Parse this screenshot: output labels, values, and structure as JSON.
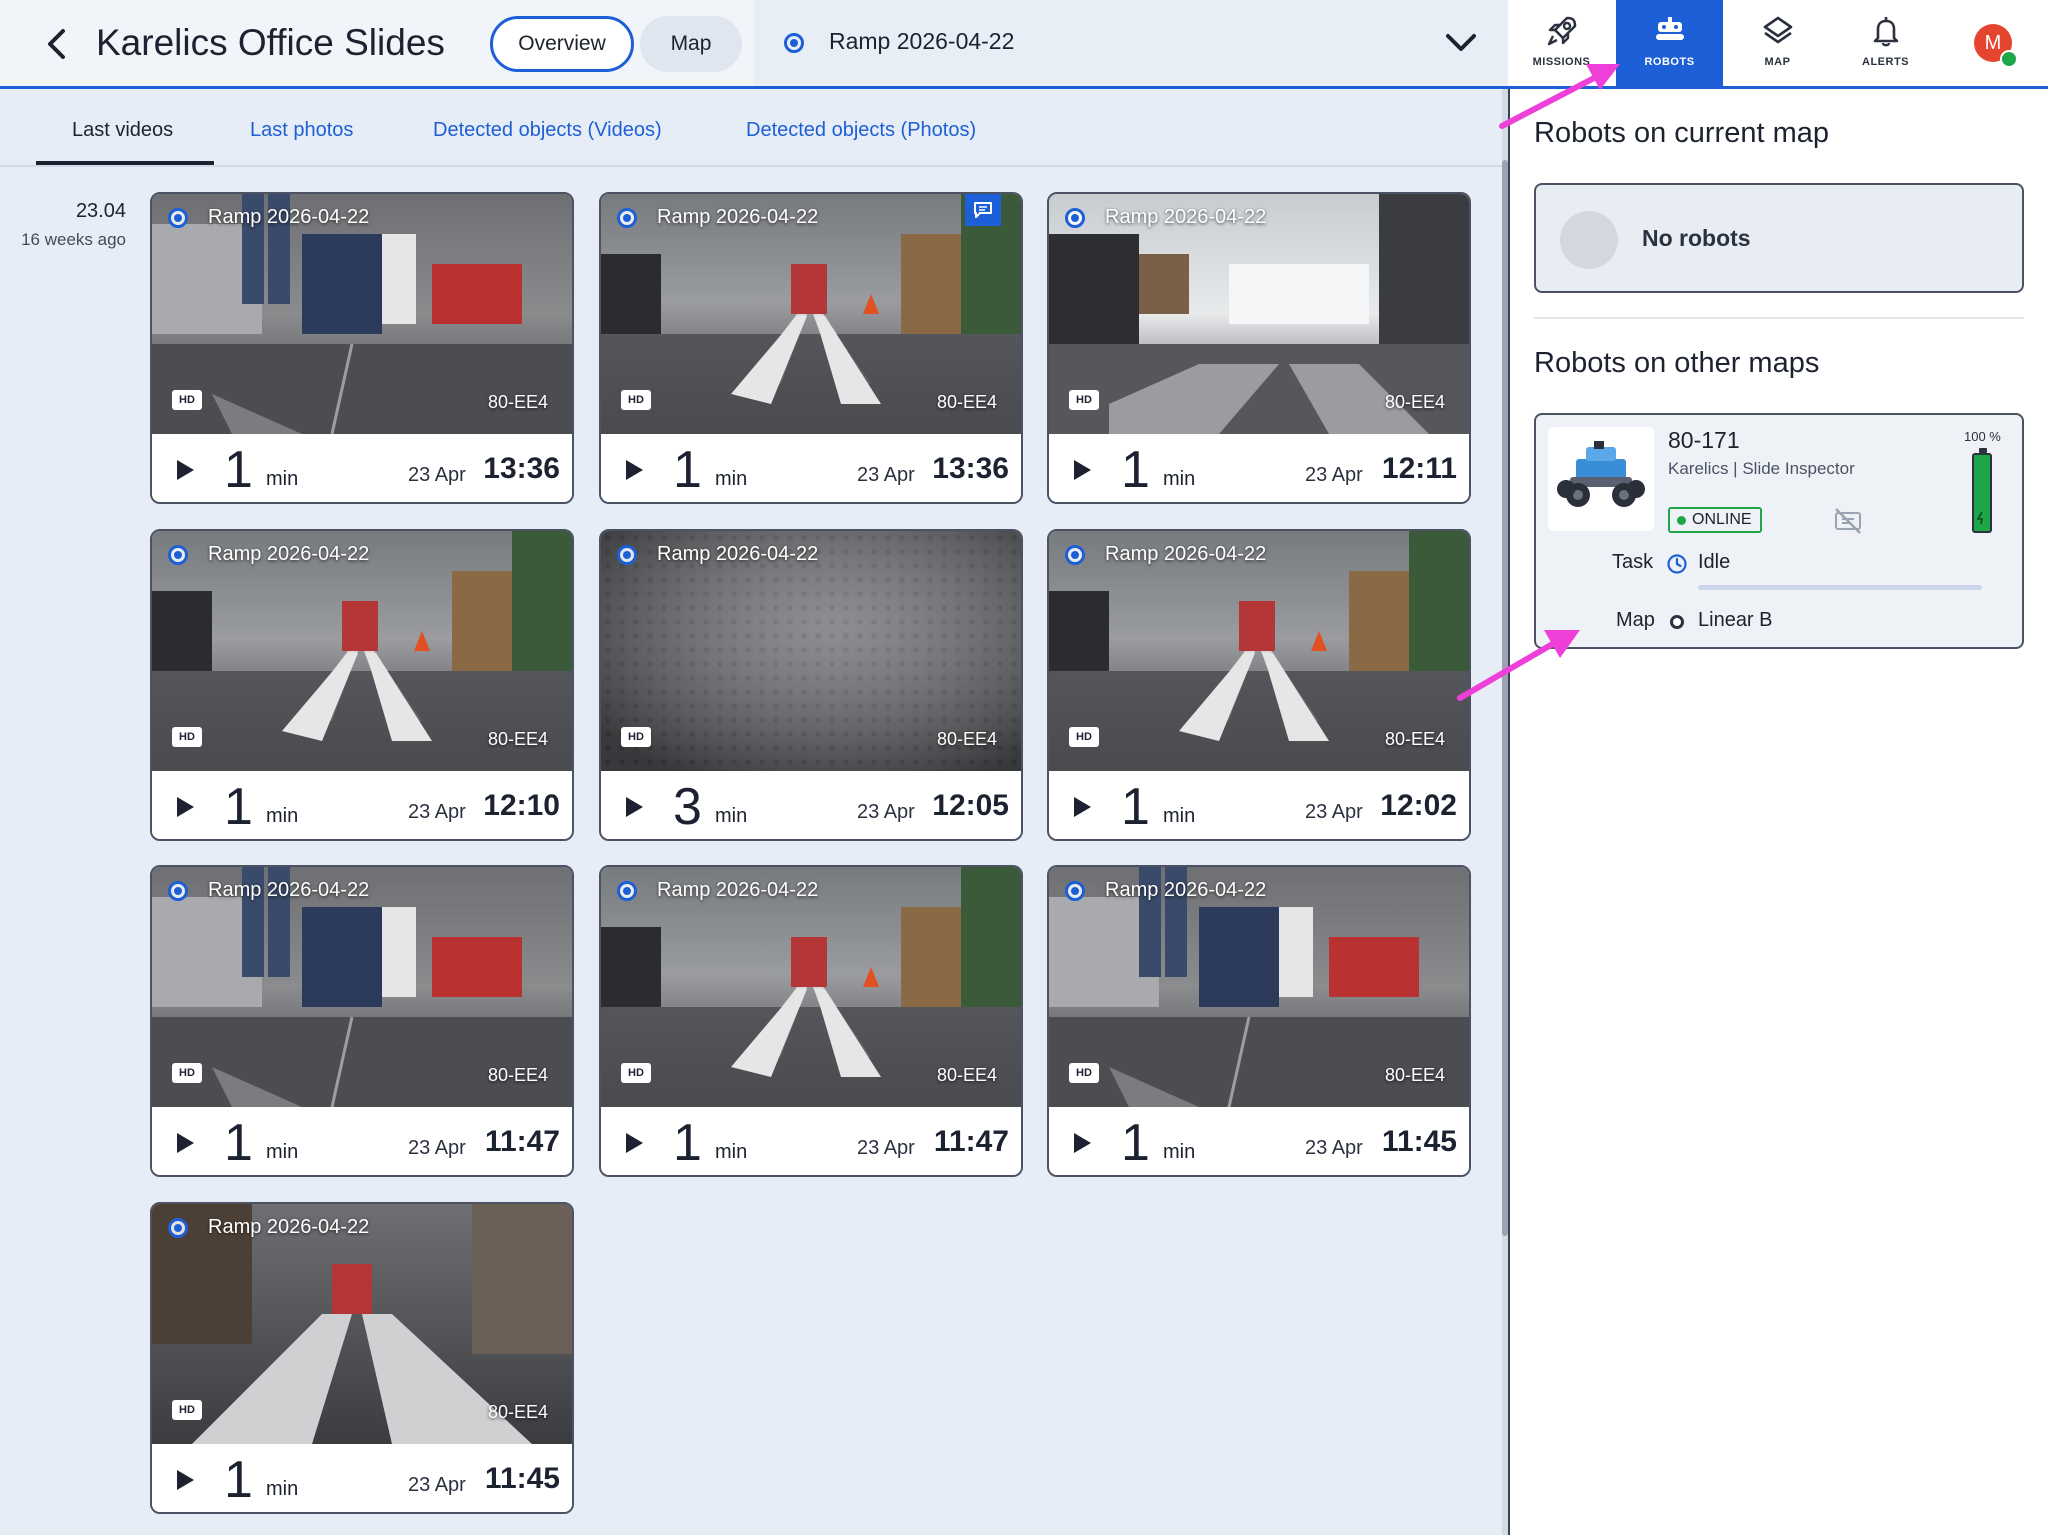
{
  "header": {
    "title": "Karelics Office Slides",
    "tab_overview": "Overview",
    "tab_map": "Map",
    "mission_select": "Ramp 2026-04-22"
  },
  "topnav": {
    "items": [
      {
        "label": "MISSIONS",
        "icon": "rocket-icon"
      },
      {
        "label": "ROBOTS",
        "icon": "robot-icon",
        "active": true
      },
      {
        "label": "MAP",
        "icon": "layers-icon"
      },
      {
        "label": "ALERTS",
        "icon": "bell-icon"
      }
    ],
    "avatar_initial": "M"
  },
  "subtabs": [
    "Last videos",
    "Last photos",
    "Detected objects (Videos)",
    "Detected objects (Photos)"
  ],
  "date_group": {
    "date": "23.04",
    "relative": "16 weeks ago"
  },
  "videos": [
    {
      "title": "Ramp 2026-04-22",
      "robot": "80-EE4",
      "badge": "HD",
      "duration": "1",
      "unit": "min",
      "date": "23 Apr",
      "time": "13:36",
      "scene": "people"
    },
    {
      "title": "Ramp 2026-04-22",
      "robot": "80-EE4",
      "badge": "HD",
      "duration": "1",
      "unit": "min",
      "date": "23 Apr",
      "time": "13:36",
      "scene": "ramp",
      "has_comment": true
    },
    {
      "title": "Ramp 2026-04-22",
      "robot": "80-EE4",
      "badge": "HD",
      "duration": "1",
      "unit": "min",
      "date": "23 Apr",
      "time": "12:11",
      "scene": "bright"
    },
    {
      "title": "Ramp 2026-04-22",
      "robot": "80-EE4",
      "badge": "HD",
      "duration": "1",
      "unit": "min",
      "date": "23 Apr",
      "time": "12:10",
      "scene": "ramp"
    },
    {
      "title": "Ramp 2026-04-22",
      "robot": "80-EE4",
      "badge": "HD",
      "duration": "3",
      "unit": "min",
      "date": "23 Apr",
      "time": "12:05",
      "scene": "floor"
    },
    {
      "title": "Ramp 2026-04-22",
      "robot": "80-EE4",
      "badge": "HD",
      "duration": "1",
      "unit": "min",
      "date": "23 Apr",
      "time": "12:02",
      "scene": "ramp"
    },
    {
      "title": "Ramp 2026-04-22",
      "robot": "80-EE4",
      "badge": "HD",
      "duration": "1",
      "unit": "min",
      "date": "23 Apr",
      "time": "11:47",
      "scene": "people"
    },
    {
      "title": "Ramp 2026-04-22",
      "robot": "80-EE4",
      "badge": "HD",
      "duration": "1",
      "unit": "min",
      "date": "23 Apr",
      "time": "11:47",
      "scene": "ramp"
    },
    {
      "title": "Ramp 2026-04-22",
      "robot": "80-EE4",
      "badge": "HD",
      "duration": "1",
      "unit": "min",
      "date": "23 Apr",
      "time": "11:45",
      "scene": "people"
    },
    {
      "title": "Ramp 2026-04-22",
      "robot": "80-EE4",
      "badge": "HD",
      "duration": "1",
      "unit": "min",
      "date": "23 Apr",
      "time": "11:45",
      "scene": "rampclose"
    }
  ],
  "right_panel": {
    "current_heading": "Robots on current map",
    "no_robots": "No robots",
    "other_heading": "Robots on other maps",
    "robot": {
      "name": "80-171",
      "subtitle": "Karelics | Slide Inspector",
      "status": "ONLINE",
      "battery": "100 %",
      "battery_level": 1.0,
      "task_label": "Task",
      "task_value": "Idle",
      "map_label": "Map",
      "map_value": "Linear B"
    }
  },
  "colors": {
    "accent": "#1d5fd6",
    "online": "#1fa64a",
    "annotation": "#ee3fd8",
    "avatar": "#e5452f"
  }
}
